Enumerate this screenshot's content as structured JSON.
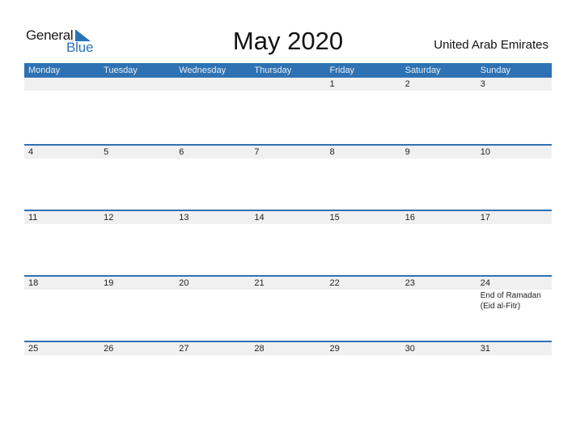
{
  "logo": {
    "general": "General",
    "blue": "Blue"
  },
  "title": "May 2020",
  "country": "United Arab Emirates",
  "colors": {
    "header": "#2e72b3",
    "date_strip": "#f0f0f0",
    "logo_blue": "#2a73b8"
  },
  "weekdays": [
    "Monday",
    "Tuesday",
    "Wednesday",
    "Thursday",
    "Friday",
    "Saturday",
    "Sunday"
  ],
  "weeks": [
    {
      "days": [
        "",
        "",
        "",
        "",
        "1",
        "2",
        "3"
      ],
      "events": [
        "",
        "",
        "",
        "",
        "",
        "",
        ""
      ]
    },
    {
      "days": [
        "4",
        "5",
        "6",
        "7",
        "8",
        "9",
        "10"
      ],
      "events": [
        "",
        "",
        "",
        "",
        "",
        "",
        ""
      ]
    },
    {
      "days": [
        "11",
        "12",
        "13",
        "14",
        "15",
        "16",
        "17"
      ],
      "events": [
        "",
        "",
        "",
        "",
        "",
        "",
        ""
      ]
    },
    {
      "days": [
        "18",
        "19",
        "20",
        "21",
        "22",
        "23",
        "24"
      ],
      "events": [
        "",
        "",
        "",
        "",
        "",
        "",
        "End of Ramadan (Eid al-Fitr)"
      ]
    },
    {
      "days": [
        "25",
        "26",
        "27",
        "28",
        "29",
        "30",
        "31"
      ],
      "events": [
        "",
        "",
        "",
        "",
        "",
        "",
        ""
      ]
    }
  ]
}
